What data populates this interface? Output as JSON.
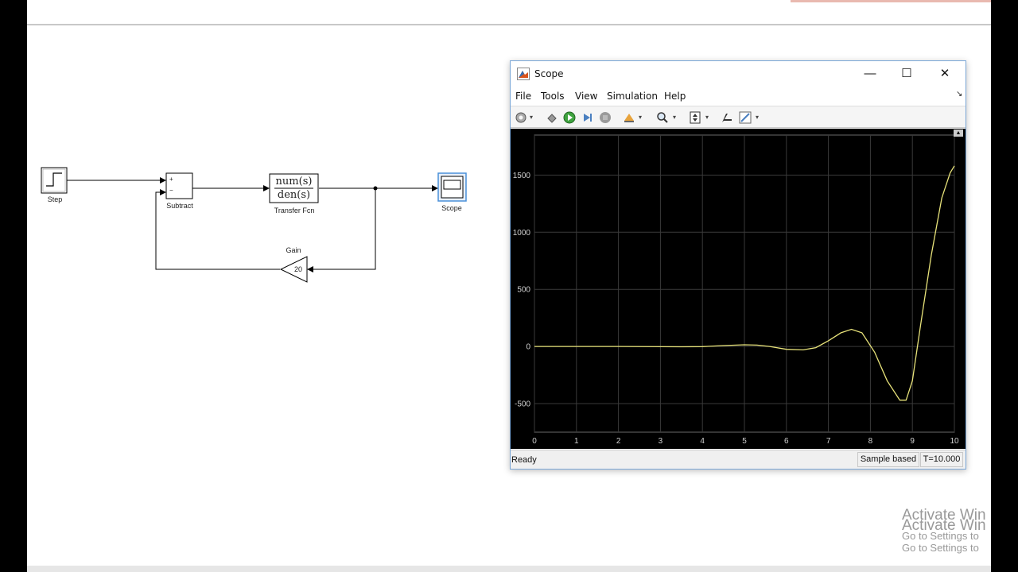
{
  "model": {
    "blocks": {
      "step_label": "Step",
      "subtract_label": "Subtract",
      "subtract_plus": "+",
      "subtract_minus": "−",
      "tf_numerator": "num(s)",
      "tf_denominator": "den(s)",
      "tf_label": "Transfer Fcn",
      "scope_label": "Scope",
      "gain_label": "Gain",
      "gain_value": "20"
    }
  },
  "scope": {
    "title": "Scope",
    "menu": [
      "File",
      "Tools",
      "View",
      "Simulation",
      "Help"
    ],
    "toolbar_icons": [
      "settings-icon",
      "restore-icon",
      "run-icon",
      "step-forward-icon",
      "stop-icon",
      "highlight-icon",
      "zoom-icon",
      "autoscale-icon",
      "measure-icon",
      "style-icon"
    ],
    "status": {
      "ready": "Ready",
      "mode": "Sample based",
      "time": "T=10.000"
    },
    "colors": {
      "plot_bg": "#000000",
      "grid": "#3a3a3a",
      "signal": "#e8e37a",
      "axis_text": "#d0d0d0"
    }
  },
  "chart_data": {
    "type": "line",
    "title": "",
    "xlabel": "",
    "ylabel": "",
    "xlim": [
      0,
      10
    ],
    "ylim": [
      -750,
      1850
    ],
    "xticks": [
      0,
      1,
      2,
      3,
      4,
      5,
      6,
      7,
      8,
      9,
      10
    ],
    "yticks": [
      -500,
      0,
      500,
      1000,
      1500
    ],
    "grid": true,
    "series": [
      {
        "x": [
          0,
          1,
          2,
          3,
          3.5,
          4,
          4.5,
          5,
          5.3,
          5.6,
          6,
          6.4,
          6.7,
          7,
          7.3,
          7.55,
          7.8,
          8.1,
          8.4,
          8.7,
          8.85,
          9,
          9.2,
          9.45,
          9.7,
          9.9,
          10
        ],
        "y": [
          0,
          0,
          0,
          -2,
          -3,
          -1,
          8,
          15,
          12,
          0,
          -25,
          -30,
          -10,
          50,
          120,
          150,
          120,
          -50,
          -300,
          -470,
          -470,
          -300,
          200,
          800,
          1300,
          1520,
          1580
        ]
      }
    ]
  },
  "watermark": {
    "line1": "Activate Win",
    "line2": "Activate Win",
    "line3": "Go to Settings to",
    "line4": "Go to Settings to"
  }
}
